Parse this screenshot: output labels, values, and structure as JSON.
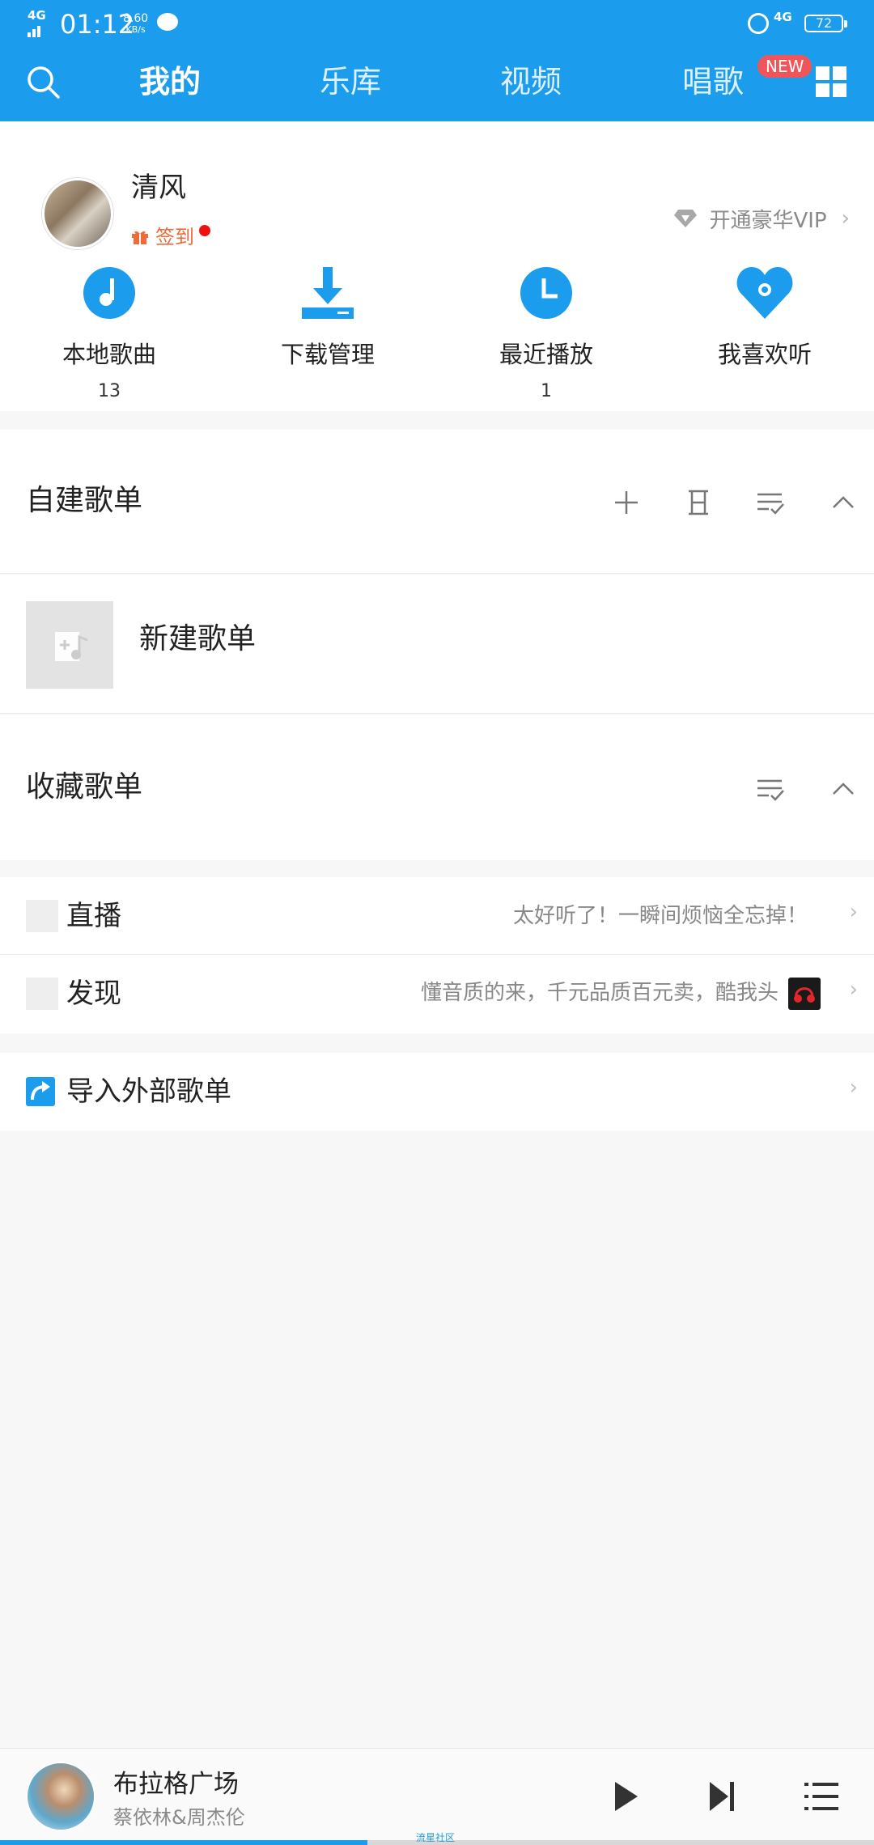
{
  "status_bar": {
    "network_left": "4G",
    "time": "01:12",
    "speed_value": "8.60",
    "speed_unit": "KB/s",
    "network_right": "4G",
    "battery": "72"
  },
  "nav": {
    "tabs": [
      "我的",
      "乐库",
      "视频",
      "唱歌"
    ],
    "active_tab": "我的",
    "new_badge": "NEW"
  },
  "profile": {
    "username": "清风",
    "signin_label": "签到",
    "vip_label": "开通豪华VIP"
  },
  "quick_actions": [
    {
      "label": "本地歌曲",
      "count": "13",
      "icon": "music-note-icon"
    },
    {
      "label": "下载管理",
      "count": "",
      "icon": "download-icon"
    },
    {
      "label": "最近播放",
      "count": "1",
      "icon": "clock-icon"
    },
    {
      "label": "我喜欢听",
      "count": "",
      "icon": "heart-icon"
    }
  ],
  "self_playlists": {
    "title": "自建歌单",
    "new_playlist_label": "新建歌单"
  },
  "collected_playlists": {
    "title": "收藏歌单"
  },
  "live": {
    "title": "直播",
    "desc": "太好听了！一瞬间烦恼全忘掉！"
  },
  "discover": {
    "title": "发现",
    "desc": "懂音质的来，千元品质百元卖，酷我头"
  },
  "import": {
    "title": "导入外部歌单"
  },
  "player": {
    "song": "布拉格广场",
    "artist": "蔡依林&周杰伦",
    "progress": 0.42,
    "watermark": "流星社区"
  },
  "colors": {
    "brand": "#1c9cec",
    "badge": "#f0555a",
    "signin": "#f06a3a"
  }
}
